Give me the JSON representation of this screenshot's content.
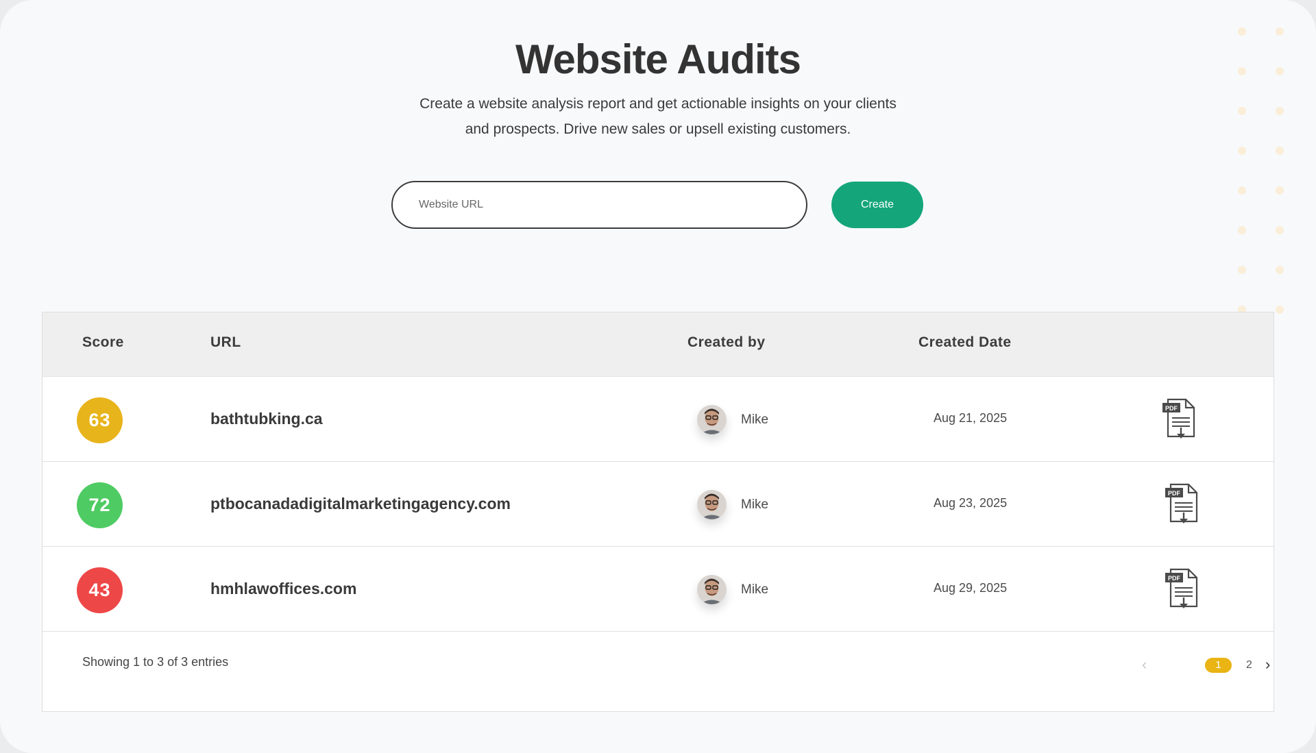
{
  "header": {
    "title": "Website Audits",
    "subtitle_line1": "Create a website analysis report and get actionable insights on your clients",
    "subtitle_line2": "and prospects. Drive new sales or upsell existing customers."
  },
  "form": {
    "url_placeholder": "Website URL",
    "url_value": "",
    "create_label": "Create",
    "create_color": "#14a67a"
  },
  "table": {
    "columns": [
      "Score",
      "URL",
      "Created by",
      "Created Date"
    ],
    "rows": [
      {
        "score": "63",
        "score_color": "#e8b41c",
        "url": "bathtubking.ca",
        "created_by": "Mike",
        "created_date": "Aug 21, 2025",
        "action_icon": "pdf-download-icon"
      },
      {
        "score": "72",
        "score_color": "#4fcb63",
        "url": "ptbocanadadigitalmarketingagency.com",
        "created_by": "Mike",
        "created_date": "Aug 23, 2025",
        "action_icon": "pdf-download-icon"
      },
      {
        "score": "43",
        "score_color": "#ee4747",
        "url": "hmhlawoffices.com",
        "created_by": "Mike",
        "created_date": "Aug 29, 2025",
        "action_icon": "pdf-download-icon"
      }
    ]
  },
  "footer": {
    "showing": "Showing 1 to 3 of 3 entries",
    "pages": [
      "1",
      "2"
    ],
    "current_page": "1",
    "accent": "#e9b414"
  }
}
